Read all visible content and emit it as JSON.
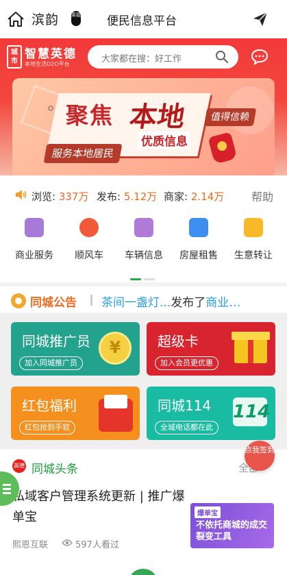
{
  "topnav": {
    "site_name": "滨韵",
    "seal_text": "英德",
    "title": "便民信息平台"
  },
  "header": {
    "logo_box_text": "城市",
    "logo_name": "智慧英德",
    "logo_sub": "本地生活O2O平台",
    "search_placeholder": "大家都在搜：好工作"
  },
  "banner": {
    "headline_a": "聚焦",
    "headline_b": "本地",
    "subline": "优质信息",
    "pill": "服务本地居民",
    "trust": "值得信赖"
  },
  "stats": {
    "views_label": "浏览:",
    "views_value": "337万",
    "posts_label": "发布:",
    "posts_value": "5.12万",
    "merchants_label": "商家:",
    "merchants_value": "2.14万",
    "help": "帮助"
  },
  "categories": [
    {
      "label": "商业服务",
      "color": "#a87ad8"
    },
    {
      "label": "顺风车",
      "color": "#f05a3a"
    },
    {
      "label": "车辆信息",
      "color": "#b07ad8"
    },
    {
      "label": "房屋租售",
      "color": "#3d8ef0"
    },
    {
      "label": "生意转让",
      "color": "#f7b82a"
    }
  ],
  "notice": {
    "title": "同城公告",
    "text_a": "茶间一盏灯...",
    "text_b": "发布了",
    "text_c": "商业…"
  },
  "cards": [
    {
      "title": "同城推广员",
      "tag": "加入同城推广员"
    },
    {
      "title": "超级卡",
      "tag": "加入会员更优惠"
    },
    {
      "title": "红包福利",
      "tag": "红包抢到手软"
    },
    {
      "title": "同城114",
      "tag": "全城电话都在此"
    }
  ],
  "card_icons": {
    "coin": "¥",
    "n114": "114"
  },
  "news": {
    "logo_text": "英德",
    "title": "同城头条",
    "all": "全部",
    "item_title": "私域客户管理系统更新 | 推广爆单宝",
    "source": "熙恩互联",
    "views": "597人看过",
    "thumb_tag": "爆单宝",
    "thumb_text": "不依托商城的成交裂变工具"
  },
  "checkin": "点我签到"
}
